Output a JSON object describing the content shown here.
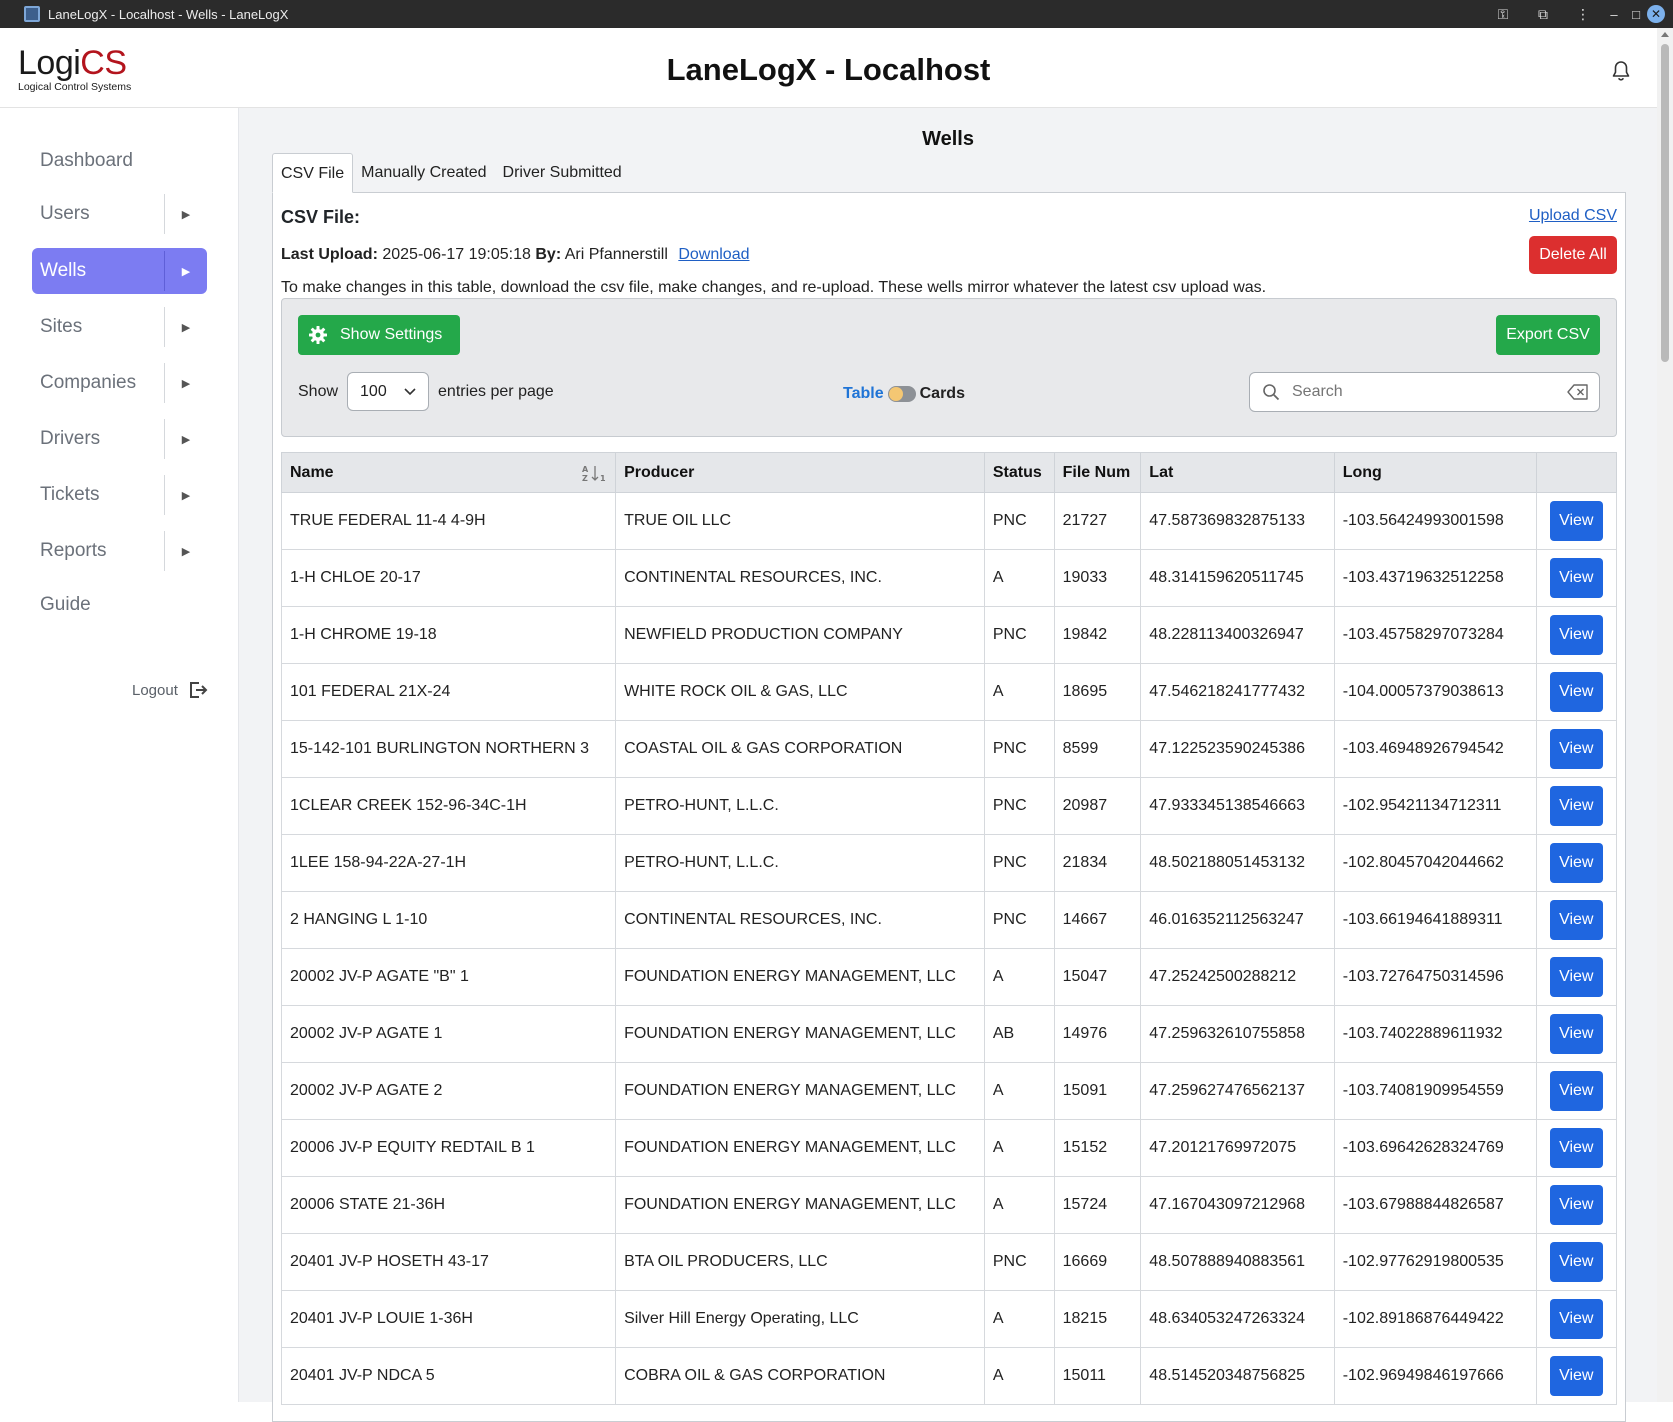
{
  "window": {
    "title": "LaneLogX - Localhost - Wells - LaneLogX"
  },
  "logo": {
    "word_a": "Logi",
    "word_b": "CS",
    "subtitle": "Logical Control Systems"
  },
  "header": {
    "title": "LaneLogX - Localhost"
  },
  "sidebar": {
    "items": [
      {
        "label": "Dashboard",
        "has_arrow": false,
        "active": false
      },
      {
        "label": "Users",
        "has_arrow": true,
        "active": false
      },
      {
        "label": "Wells",
        "has_arrow": true,
        "active": true
      },
      {
        "label": "Sites",
        "has_arrow": true,
        "active": false
      },
      {
        "label": "Companies",
        "has_arrow": true,
        "active": false
      },
      {
        "label": "Drivers",
        "has_arrow": true,
        "active": false
      },
      {
        "label": "Tickets",
        "has_arrow": true,
        "active": false
      },
      {
        "label": "Reports",
        "has_arrow": true,
        "active": false
      },
      {
        "label": "Guide",
        "has_arrow": false,
        "active": false
      }
    ],
    "logout_label": "Logout"
  },
  "page": {
    "title": "Wells",
    "tabs": [
      {
        "label": "CSV File",
        "active": true
      },
      {
        "label": "Manually Created",
        "active": false
      },
      {
        "label": "Driver Submitted",
        "active": false
      }
    ],
    "csv_heading": "CSV File:",
    "upload_csv_label": "Upload CSV",
    "last_upload_label": "Last Upload:",
    "last_upload_value": "2025-06-17 19:05:18",
    "by_label": "By:",
    "by_value": "Ari Pfannerstill",
    "download_label": "Download",
    "delete_all_label": "Delete All",
    "notice": "To make changes in this table, download the csv file, make changes, and re-upload. These wells mirror whatever the latest csv upload was."
  },
  "controls": {
    "show_settings_label": "Show Settings",
    "export_csv_label": "Export CSV",
    "show_label": "Show",
    "entries_value": "100",
    "entries_suffix": "entries per page",
    "view_table_label": "Table",
    "view_cards_label": "Cards",
    "search_placeholder": "Search"
  },
  "table": {
    "columns": [
      "Name",
      "Producer",
      "Status",
      "File Num",
      "Lat",
      "Long"
    ],
    "view_label": "View",
    "rows": [
      [
        "TRUE FEDERAL 11-4 4-9H",
        "TRUE OIL LLC",
        "PNC",
        "21727",
        "47.587369832875133",
        "-103.56424993001598"
      ],
      [
        "1-H CHLOE 20-17",
        "CONTINENTAL RESOURCES, INC.",
        "A",
        "19033",
        "48.314159620511745",
        "-103.43719632512258"
      ],
      [
        "1-H CHROME 19-18",
        "NEWFIELD PRODUCTION COMPANY",
        "PNC",
        "19842",
        "48.228113400326947",
        "-103.45758297073284"
      ],
      [
        "101 FEDERAL 21X-24",
        "WHITE ROCK OIL & GAS, LLC",
        "A",
        "18695",
        "47.546218241777432",
        "-104.00057379038613"
      ],
      [
        "15-142-101 BURLINGTON NORTHERN 3",
        "COASTAL OIL & GAS CORPORATION",
        "PNC",
        "8599",
        "47.122523590245386",
        "-103.46948926794542"
      ],
      [
        "1CLEAR CREEK 152-96-34C-1H",
        "PETRO-HUNT, L.L.C.",
        "PNC",
        "20987",
        "47.933345138546663",
        "-102.95421134712311"
      ],
      [
        "1LEE 158-94-22A-27-1H",
        "PETRO-HUNT, L.L.C.",
        "PNC",
        "21834",
        "48.502188051453132",
        "-102.80457042044662"
      ],
      [
        "2 HANGING L 1-10",
        "CONTINENTAL RESOURCES, INC.",
        "PNC",
        "14667",
        "46.016352112563247",
        "-103.66194641889311"
      ],
      [
        "20002 JV-P AGATE \"B\" 1",
        "FOUNDATION ENERGY MANAGEMENT, LLC",
        "A",
        "15047",
        "47.25242500288212",
        "-103.72764750314596"
      ],
      [
        "20002 JV-P AGATE 1",
        "FOUNDATION ENERGY MANAGEMENT, LLC",
        "AB",
        "14976",
        "47.259632610755858",
        "-103.74022889611932"
      ],
      [
        "20002 JV-P AGATE 2",
        "FOUNDATION ENERGY MANAGEMENT, LLC",
        "A",
        "15091",
        "47.259627476562137",
        "-103.74081909954559"
      ],
      [
        "20006 JV-P EQUITY REDTAIL B 1",
        "FOUNDATION ENERGY MANAGEMENT, LLC",
        "A",
        "15152",
        "47.20121769972075",
        "-103.69642628324769"
      ],
      [
        "20006 STATE 21-36H",
        "FOUNDATION ENERGY MANAGEMENT, LLC",
        "A",
        "15724",
        "47.167043097212968",
        "-103.67988844826587"
      ],
      [
        "20401 JV-P HOSETH 43-17",
        "BTA OIL PRODUCERS, LLC",
        "PNC",
        "16669",
        "48.507888940883561",
        "-102.97762919800535"
      ],
      [
        "20401 JV-P LOUIE 1-36H",
        "Silver Hill Energy Operating, LLC",
        "A",
        "18215",
        "48.634053247263324",
        "-102.89186876449422"
      ],
      [
        "20401 JV-P NDCA 5",
        "COBRA OIL & GAS CORPORATION",
        "A",
        "15011",
        "48.514520348756825",
        "-102.96949846197666"
      ]
    ]
  },
  "colors": {
    "active_nav": "#7c7cf2",
    "green_button": "#24a84a",
    "red_button": "#dc2f2f",
    "view_button": "#1f66e0",
    "logo_accent": "#b3141d"
  }
}
